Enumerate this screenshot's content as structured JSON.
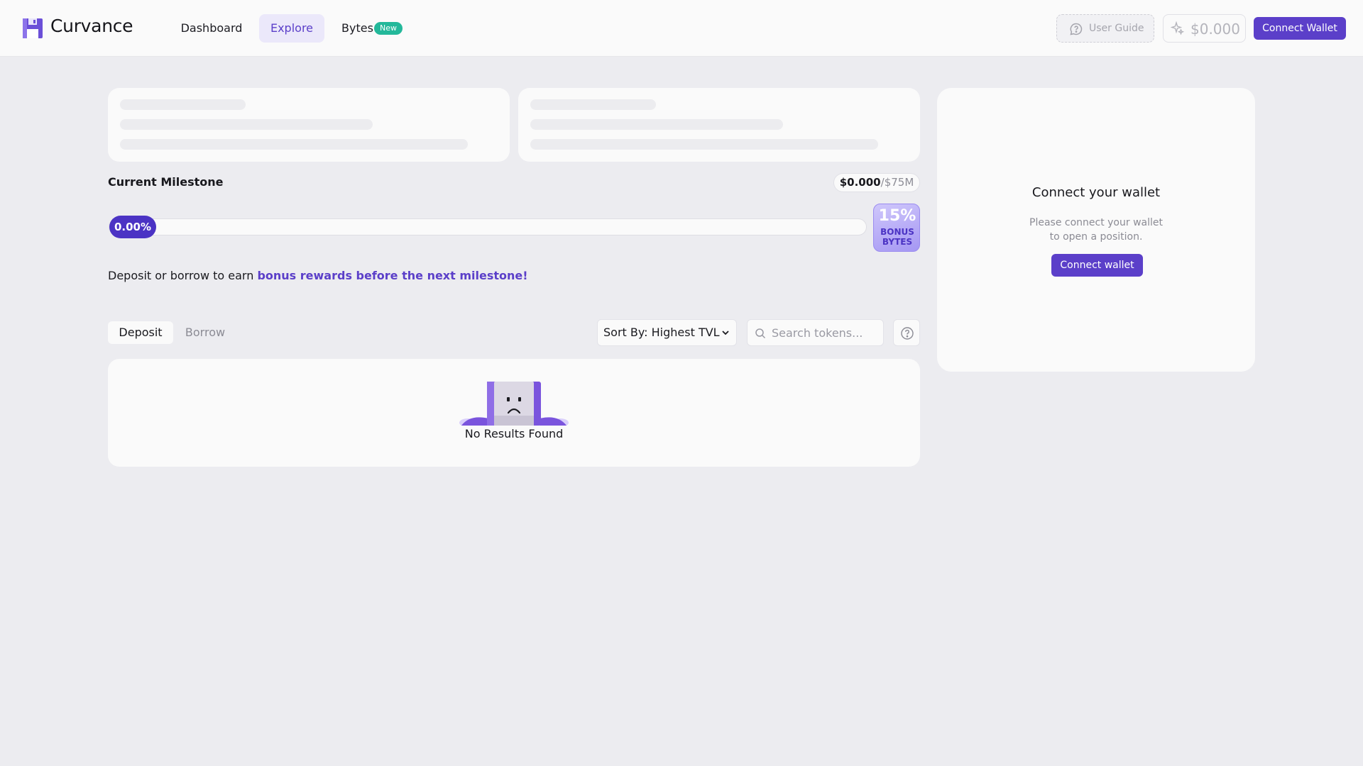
{
  "header": {
    "brand": "Curvance",
    "nav": {
      "dashboard": "Dashboard",
      "explore": "Explore",
      "bytes": "Bytes",
      "bytes_badge": "New"
    },
    "user_guide": "User Guide",
    "balance": "$0.000",
    "connect_wallet": "Connect Wallet"
  },
  "milestone": {
    "title": "Current Milestone",
    "current": "$0.000",
    "separator": "/",
    "goal": "$75M",
    "progress_label": "0.00%",
    "progress_value": 0.0,
    "bonus_percent": "15%",
    "bonus_line1": "BONUS",
    "bonus_line2": "BYTES"
  },
  "earn": {
    "prefix": "Deposit or borrow to earn ",
    "highlight": "bonus rewards before the next milestone!"
  },
  "tabs": {
    "deposit": "Deposit",
    "borrow": "Borrow",
    "active": "deposit"
  },
  "sort": {
    "label": "Sort By: Highest TVL"
  },
  "search": {
    "placeholder": "Search tokens...",
    "value": ""
  },
  "empty_state": {
    "text": "No Results Found"
  },
  "wallet_panel": {
    "title": "Connect your wallet",
    "description": "Please connect your wallet to open a position.",
    "button": "Connect wallet"
  },
  "colors": {
    "accent": "#5b3fc9",
    "accent_dark": "#4b33c4",
    "badge_green": "#23b89a",
    "background": "#ececf0",
    "card": "#fafafa"
  },
  "icons": {
    "logo": "floppy-disk-logo",
    "guide": "chat-question-icon",
    "balance": "sparkle-icon",
    "sort": "chevron-down-icon",
    "search": "search-icon",
    "help": "help-circle-icon",
    "empty": "sad-mascot"
  }
}
